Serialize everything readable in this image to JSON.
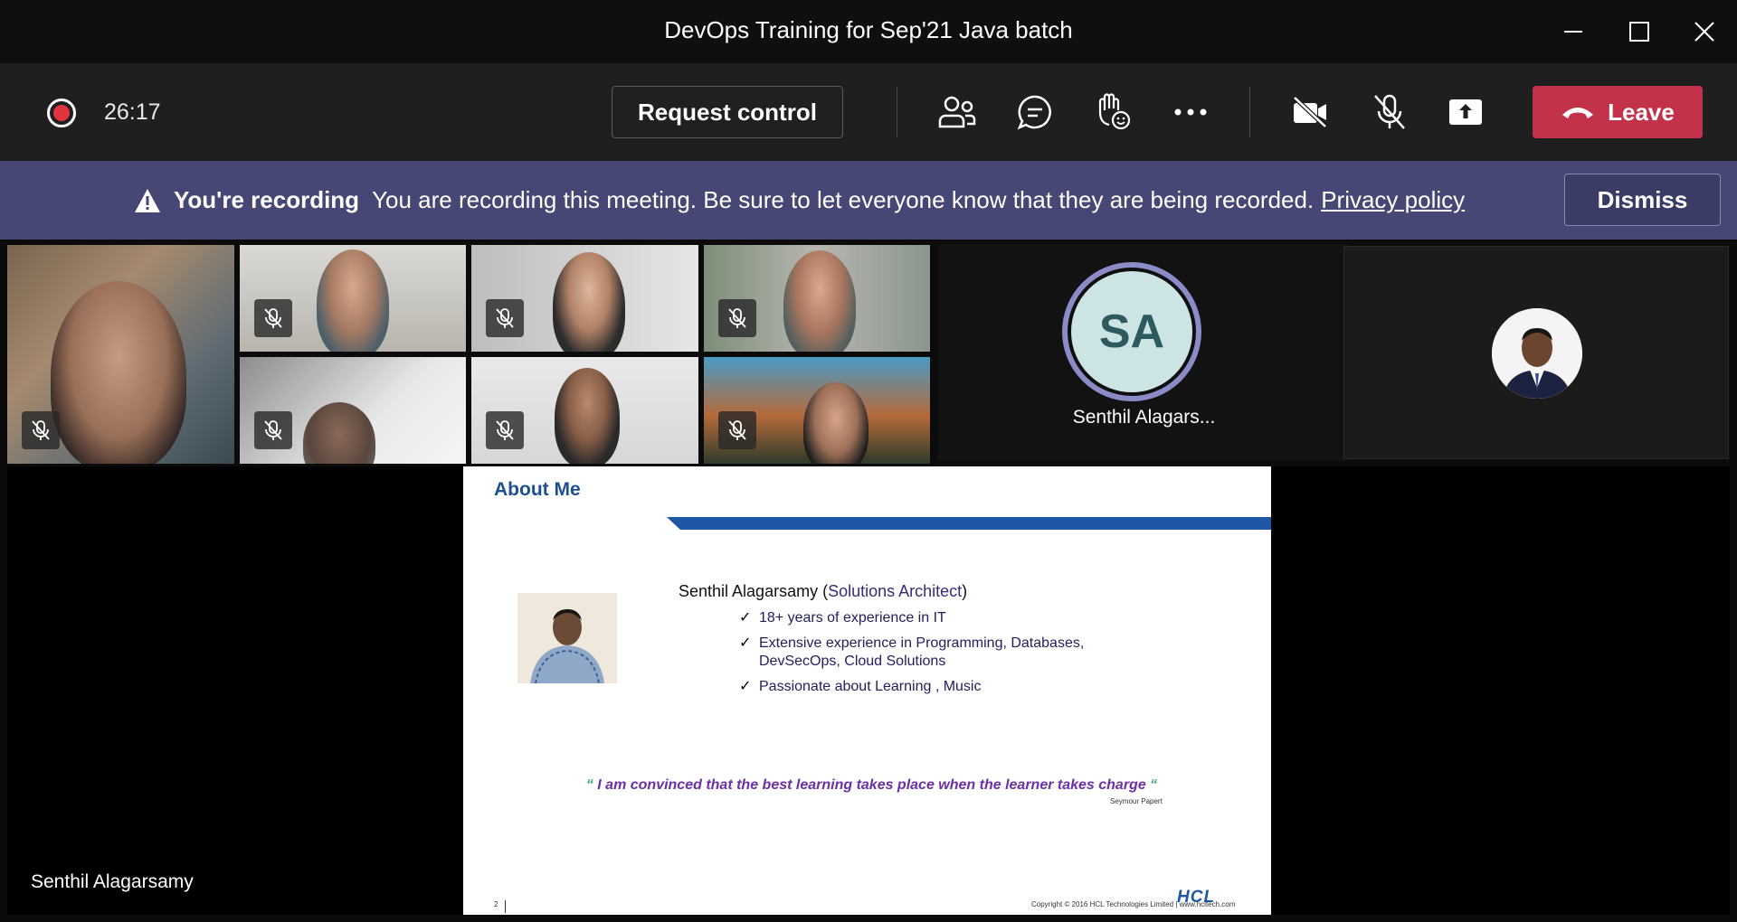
{
  "window": {
    "title": "DevOps Training for Sep'21 Java batch"
  },
  "toolbar": {
    "timer": "26:17",
    "request_control_label": "Request control",
    "leave_label": "Leave"
  },
  "banner": {
    "heading": "You're recording",
    "message": "You are recording this meeting. Be sure to let everyone know that they are being recorded.",
    "link": "Privacy policy",
    "dismiss_label": "Dismiss"
  },
  "participants": {
    "sa_initials": "SA",
    "sa_name": "Senthil Alagars..."
  },
  "slide": {
    "title": "About Me",
    "name": "Senthil Alagarsamy (",
    "role": "Solutions Architect",
    "role_close": ")",
    "bullets": [
      "18+ years of experience in IT",
      "Extensive experience in Programming, Databases,",
      "DevSecOps, Cloud Solutions",
      "Passionate about Learning , Music"
    ],
    "quote": "I am convinced that the best learning takes place when the learner takes charge",
    "quote_open": "“",
    "quote_close": "“",
    "author": "Seymour Papert",
    "page": "2",
    "logo": "HCL",
    "copyright": "Copyright © 2016 HCL Technologies Limited  |  www.hcltech.com"
  },
  "presenter_name": "Senthil Alagarsamy",
  "colors": {
    "leave": "#c4314b",
    "banner": "#464775",
    "record": "#e0343e",
    "avatar_ring": "#8b8cc7"
  }
}
